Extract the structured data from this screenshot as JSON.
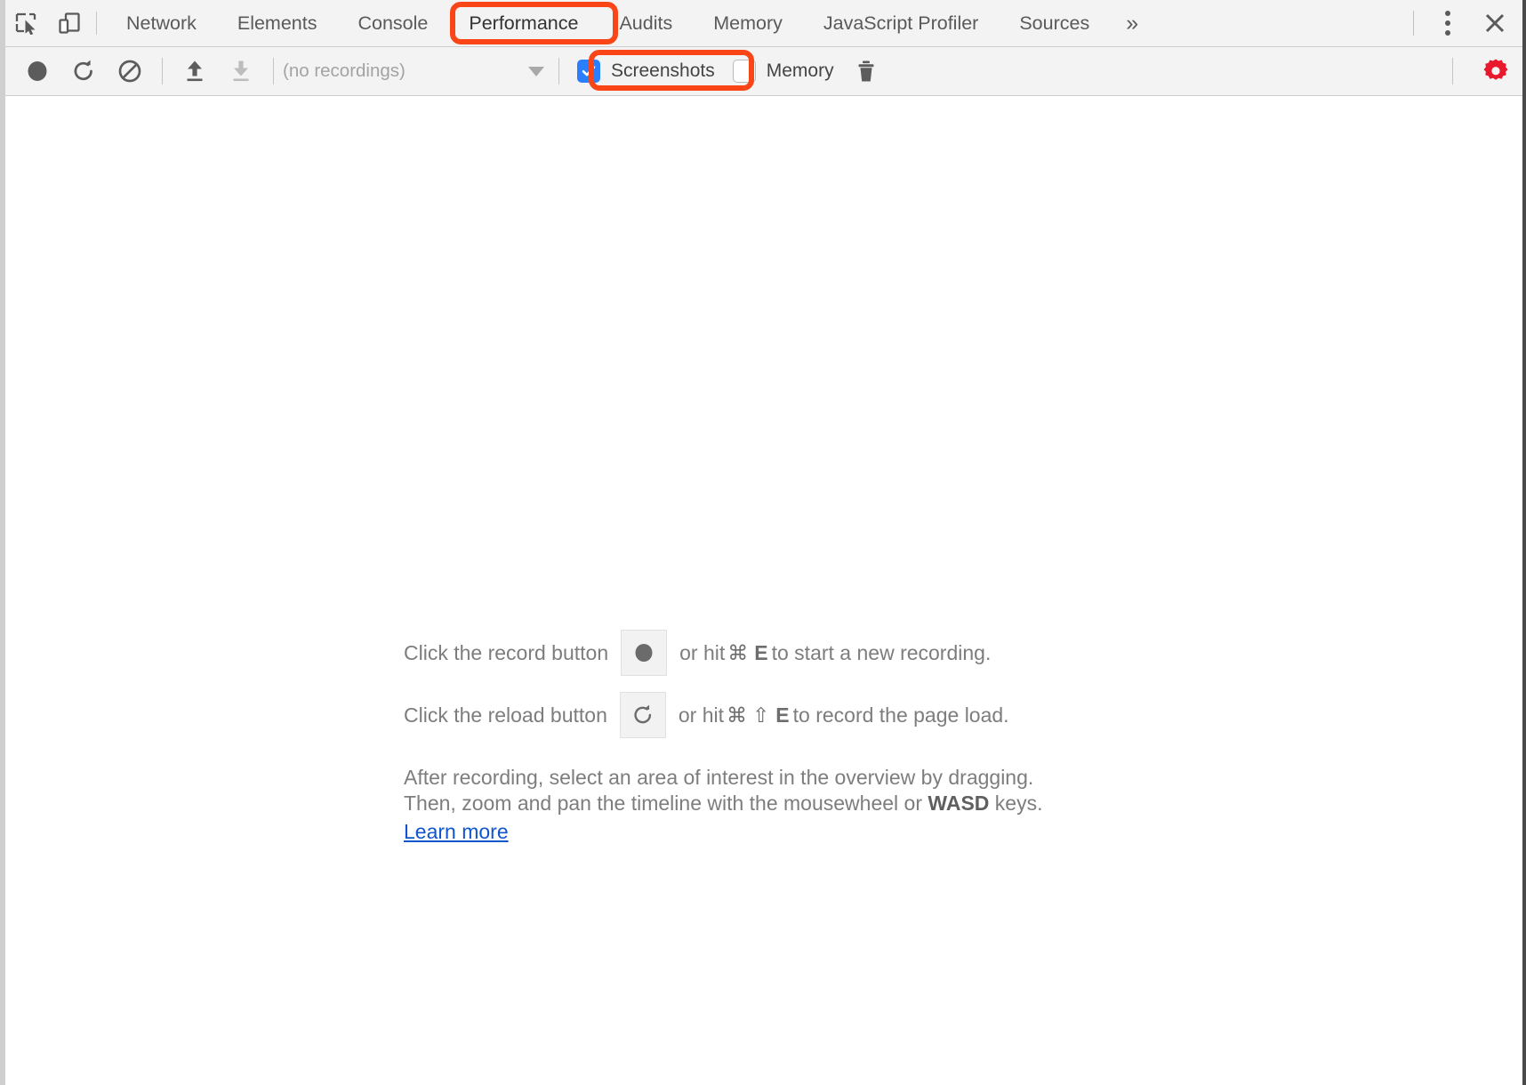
{
  "window": {
    "accent_color": "#fa4616",
    "toolbar_bg": "#f3f3f3",
    "panel_bg": "#ffffff",
    "link_color": "#1155cc",
    "checkbox_checked_color": "#2a7fff",
    "gear_active_color": "#e8192c"
  },
  "tabbar": {
    "inspect_icon": "inspect-element-icon",
    "device_icon": "device-toolbar-icon",
    "tabs": [
      {
        "label": "Network",
        "selected": false
      },
      {
        "label": "Elements",
        "selected": false
      },
      {
        "label": "Console",
        "selected": false
      },
      {
        "label": "Performance",
        "selected": true
      },
      {
        "label": "Audits",
        "selected": false
      },
      {
        "label": "Memory",
        "selected": false
      },
      {
        "label": "JavaScript Profiler",
        "selected": false
      },
      {
        "label": "Sources",
        "selected": false
      }
    ],
    "more_tabs_label": "»",
    "more_options_icon": "kebab-menu-icon",
    "close_icon": "close-icon",
    "close_glyph": "✕"
  },
  "perf_toolbar": {
    "record_icon": "record-icon",
    "reload_icon": "reload-record-icon",
    "clear_icon": "clear-icon",
    "upload_icon": "upload-profile-icon",
    "download_icon": "download-profile-icon",
    "recordings_select": {
      "value": "(no recordings)",
      "options": [
        "(no recordings)"
      ]
    },
    "screenshots": {
      "label": "Screenshots",
      "checked": true
    },
    "memory": {
      "label": "Memory",
      "checked": false
    },
    "trash_icon": "trash-icon",
    "settings_icon": "settings-gear-icon"
  },
  "landing": {
    "line1": {
      "prefix": "Click the record button",
      "chip_icon": "record-icon",
      "middle": "or hit",
      "key_cmd": "⌘",
      "key_letter": "E",
      "suffix": "to start a new recording."
    },
    "line2": {
      "prefix": "Click the reload button",
      "chip_icon": "reload-icon",
      "middle": "or hit",
      "key_cmd": "⌘",
      "key_shift": "⇧",
      "key_letter": "E",
      "suffix": "to record the page load."
    },
    "paragraph_line1": "After recording, select an area of interest in the overview by dragging.",
    "paragraph_line2_pre": "Then, zoom and pan the timeline with the mousewheel or ",
    "paragraph_line2_bold": "WASD",
    "paragraph_line2_post": " keys.",
    "learn_more": "Learn more"
  },
  "annotations": [
    {
      "name": "performance-tab-highlight",
      "target": "Performance"
    },
    {
      "name": "screenshots-checkbox-highlight",
      "target": "Screenshots"
    }
  ]
}
